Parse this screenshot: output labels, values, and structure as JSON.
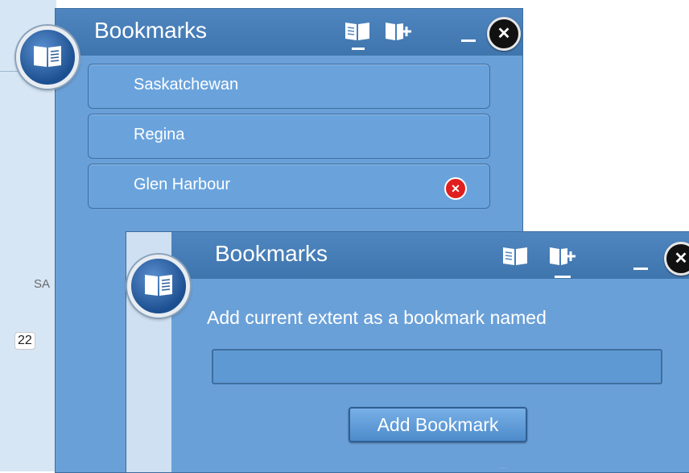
{
  "map": {
    "scale_value": "22",
    "partial_label": "SA"
  },
  "list_widget": {
    "title": "Bookmarks",
    "icons": [
      "bookmark-list-icon",
      "add-bookmark-icon"
    ],
    "items": [
      {
        "label": "Saskatchewan"
      },
      {
        "label": "Regina"
      },
      {
        "label": "Glen Harbour"
      }
    ]
  },
  "add_widget": {
    "title": "Bookmarks",
    "prompt": "Add current extent as a bookmark named",
    "name_value": "",
    "add_button_label": "Add Bookmark"
  },
  "colors": {
    "header": "#4580bd",
    "body": "#6aa0d8",
    "delete": "#e01e1e"
  }
}
